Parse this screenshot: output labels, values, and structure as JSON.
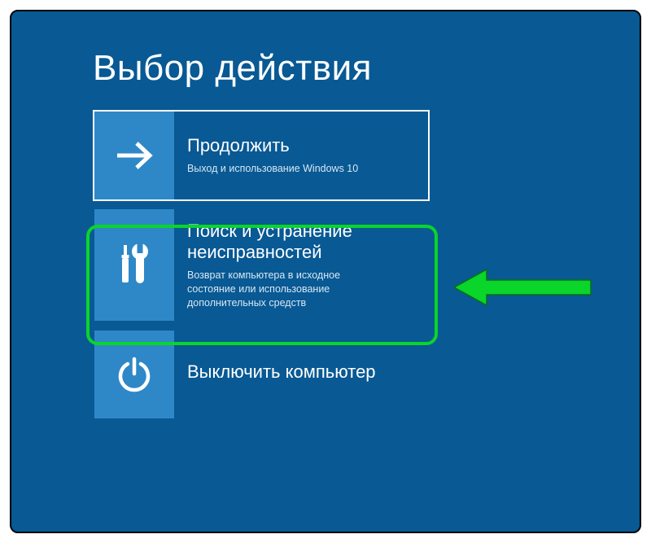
{
  "title": "Выбор действия",
  "tiles": {
    "continue": {
      "heading": "Продолжить",
      "sub": "Выход и использование Windows 10"
    },
    "troubleshoot": {
      "heading": "Поиск и устранение неисправностей",
      "sub": "Возврат компьютера в исходное состояние или использование дополнительных средств"
    },
    "shutdown": {
      "heading": "Выключить компьютер",
      "sub": ""
    }
  },
  "colors": {
    "bg": "#085994",
    "tile_icon_bg": "#2e88c8",
    "highlight": "#09d52a"
  }
}
